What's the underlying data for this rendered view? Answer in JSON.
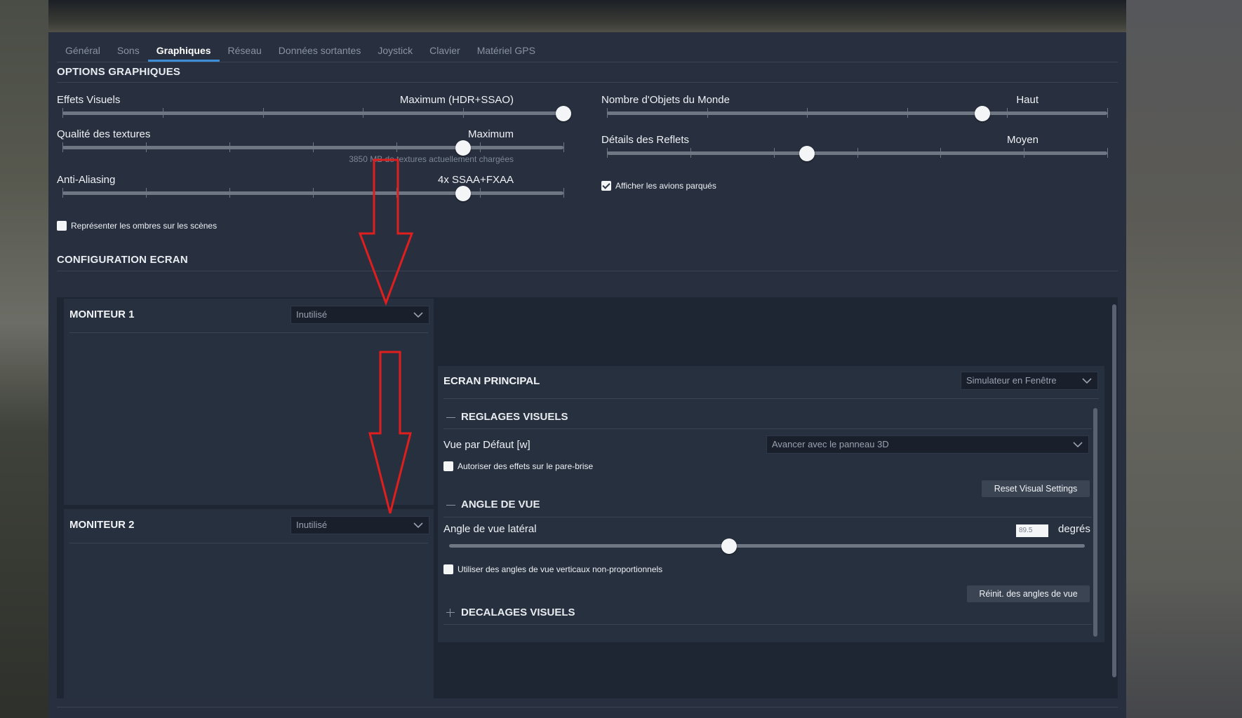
{
  "tabs": [
    "Général",
    "Sons",
    "Graphiques",
    "Réseau",
    "Données sortantes",
    "Joystick",
    "Clavier",
    "Matériel GPS"
  ],
  "active_tab": "Graphiques",
  "graphics": {
    "title": "OPTIONS GRAPHIQUES",
    "visual_effects": {
      "label": "Effets Visuels",
      "value": "Maximum (HDR+SSAO)",
      "level": 1.0
    },
    "texture_quality": {
      "label": "Qualité des textures",
      "value": "Maximum",
      "level": 0.8,
      "note": "3850 MB de textures actuellement chargées"
    },
    "anti_aliasing": {
      "label": "Anti-Aliasing",
      "value": "4x SSAA+FXAA",
      "level": 0.8
    },
    "shadows_checkbox": {
      "label": "Représenter les ombres sur les scènes",
      "checked": false
    },
    "world_objects": {
      "label": "Nombre d'Objets du Monde",
      "value": "Haut",
      "level": 0.75
    },
    "reflections": {
      "label": "Détails des Reflets",
      "value": "Moyen",
      "level": 0.4
    },
    "parked_aircraft_checkbox": {
      "label": "Afficher les avions parqués",
      "checked": true
    }
  },
  "screen": {
    "title": "CONFIGURATION ECRAN",
    "monitor1": {
      "title": "MONITEUR 1",
      "select": "Inutilisé"
    },
    "monitor2": {
      "title": "MONITEUR 2",
      "select": "Inutilisé"
    },
    "main": {
      "title": "ECRAN PRINCIPAL",
      "mode_select": "Simulateur en Fenêtre",
      "visual_settings": {
        "title": "REGLAGES VISUELS",
        "default_view_label": "Vue par Défaut [w]",
        "default_view_select": "Avancer avec le panneau 3D",
        "windshield_checkbox": {
          "label": "Autoriser des effets sur le pare-brise",
          "checked": false
        },
        "reset_button": "Reset Visual Settings"
      },
      "view_angle": {
        "title": "ANGLE DE VUE",
        "lateral_label": "Angle de vue latéral",
        "lateral_value": "89.5",
        "unit": "degrés",
        "level": 0.44,
        "vertical_checkbox": {
          "label": "Utiliser des angles de vue verticaux non-proportionnels",
          "checked": false
        },
        "reset_button": "Réinit. des angles de vue"
      },
      "visual_offsets": {
        "title": "DECALAGES VISUELS"
      }
    }
  },
  "colors": {
    "accent": "#3c8fd6",
    "annotation": "#e01e1e",
    "panel": "#27303e"
  }
}
